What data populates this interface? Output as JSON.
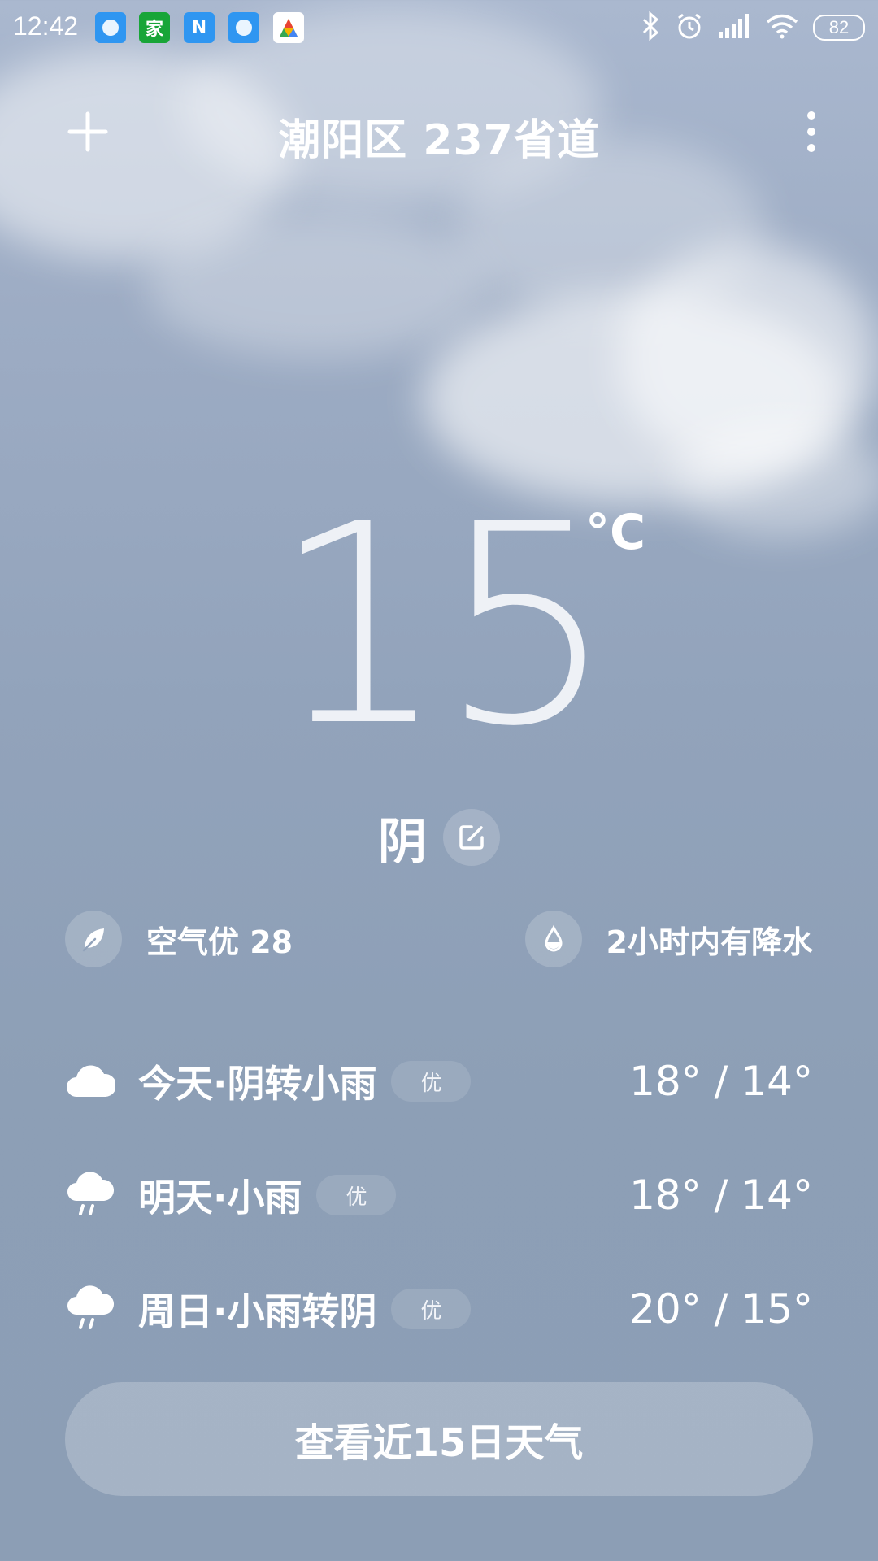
{
  "status_bar": {
    "time": "12:42",
    "battery": "82",
    "app_icons": [
      {
        "name": "browser-app-icon",
        "label": ""
      },
      {
        "name": "green-app-icon",
        "label": "家"
      },
      {
        "name": "n-app-icon",
        "label": "N"
      },
      {
        "name": "browser-app-icon-2",
        "label": ""
      },
      {
        "name": "a-app-icon",
        "label": ""
      }
    ],
    "indicators": [
      "bluetooth-icon",
      "alarm-icon",
      "signal-icon",
      "wifi-icon"
    ]
  },
  "header": {
    "location": "潮阳区 237省道"
  },
  "current": {
    "temperature": "15",
    "unit": "°C",
    "condition": "阴"
  },
  "info": {
    "air_quality": "空气优 28",
    "precipitation": "2小时内有降水"
  },
  "forecast": [
    {
      "label": "今天·阴转小雨",
      "aqi": "优",
      "temp": "18° / 14°",
      "icon": "cloudy-icon"
    },
    {
      "label": "明天·小雨",
      "aqi": "优",
      "temp": "18° / 14°",
      "icon": "light-rain-icon"
    },
    {
      "label": "周日·小雨转阴",
      "aqi": "优",
      "temp": "20° / 15°",
      "icon": "light-rain-icon"
    }
  ],
  "actions": {
    "fifteen_day_label": "查看近15日天气"
  },
  "colors": {
    "background_top": "#aab8cf",
    "background_bottom": "#8c9eb5",
    "text": "#ffffff"
  }
}
